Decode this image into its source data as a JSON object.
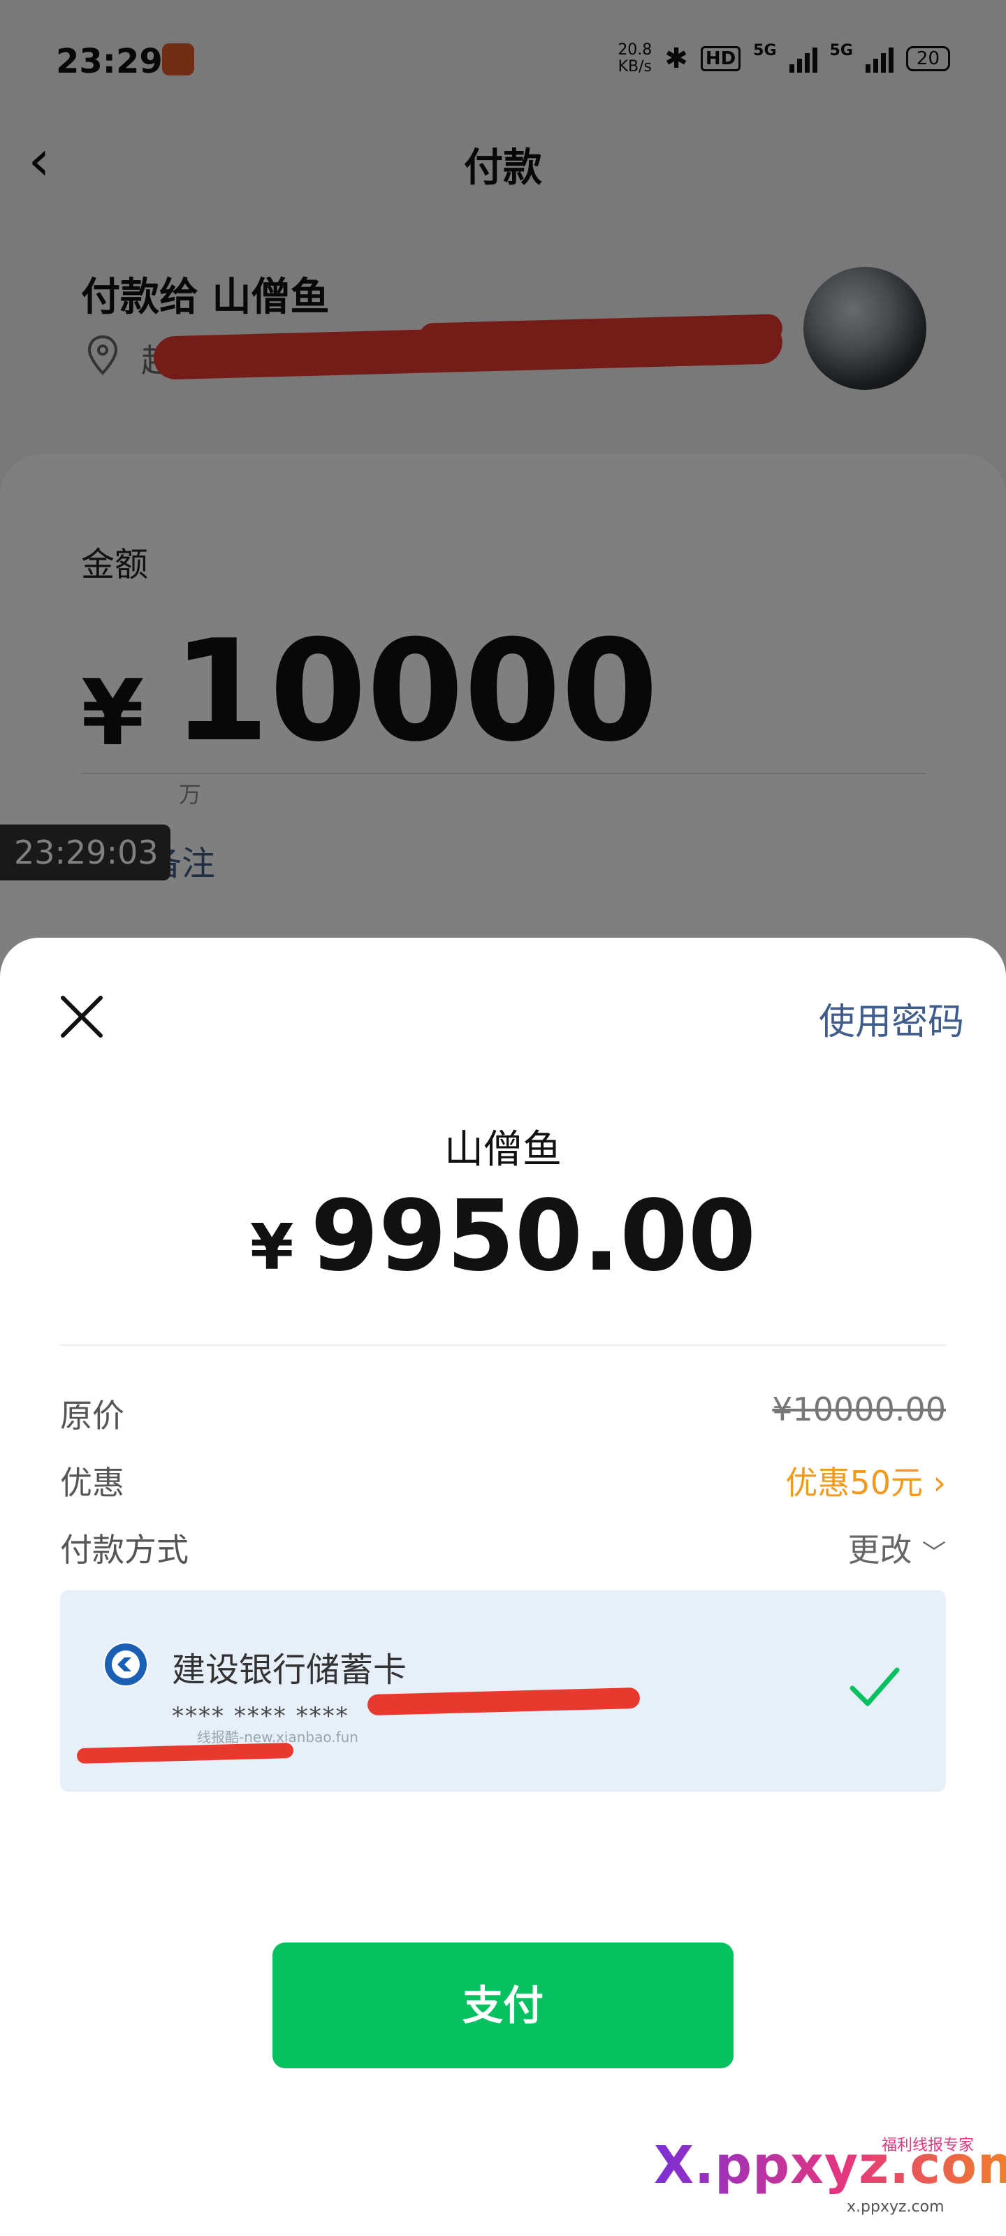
{
  "status_bar": {
    "time": "23:29",
    "net_speed_value": "20.8",
    "net_speed_unit": "KB/s",
    "hd_label": "HD",
    "net1": "5G",
    "net2": "5G",
    "battery": "20"
  },
  "nav": {
    "title": "付款"
  },
  "payee": {
    "line": "付款给 山僧鱼",
    "location": "超然台"
  },
  "amount_form": {
    "label": "金额",
    "currency": "¥",
    "value": "10000",
    "unit_hint": "万",
    "remark_link": "添加备注",
    "timestamp": "23:29:03"
  },
  "sheet": {
    "use_password": "使用密码",
    "payee_name": "山僧鱼",
    "currency": "¥",
    "amount": "9950.00",
    "rows": {
      "original_label": "原价",
      "original_value": "¥10000.00",
      "discount_label": "优惠",
      "discount_value": "优惠50元",
      "method_label": "付款方式",
      "method_value": "更改"
    },
    "card": {
      "bank_name": "建设银行储蓄卡",
      "card_number": "**** **** ****"
    },
    "pay_button": "支付"
  },
  "watermark": {
    "small_text": "线报酷-new.xianbao.fun",
    "brand": "X.ppxyz.com",
    "tag": "福利线报专家",
    "url": "x.ppxyz.com"
  },
  "colors": {
    "accent_green": "#07c160",
    "link_blue": "#3f5c8a",
    "discount_orange": "#f29a1f",
    "card_bg": "#e7f0f9",
    "redaction": "#e8392e"
  }
}
